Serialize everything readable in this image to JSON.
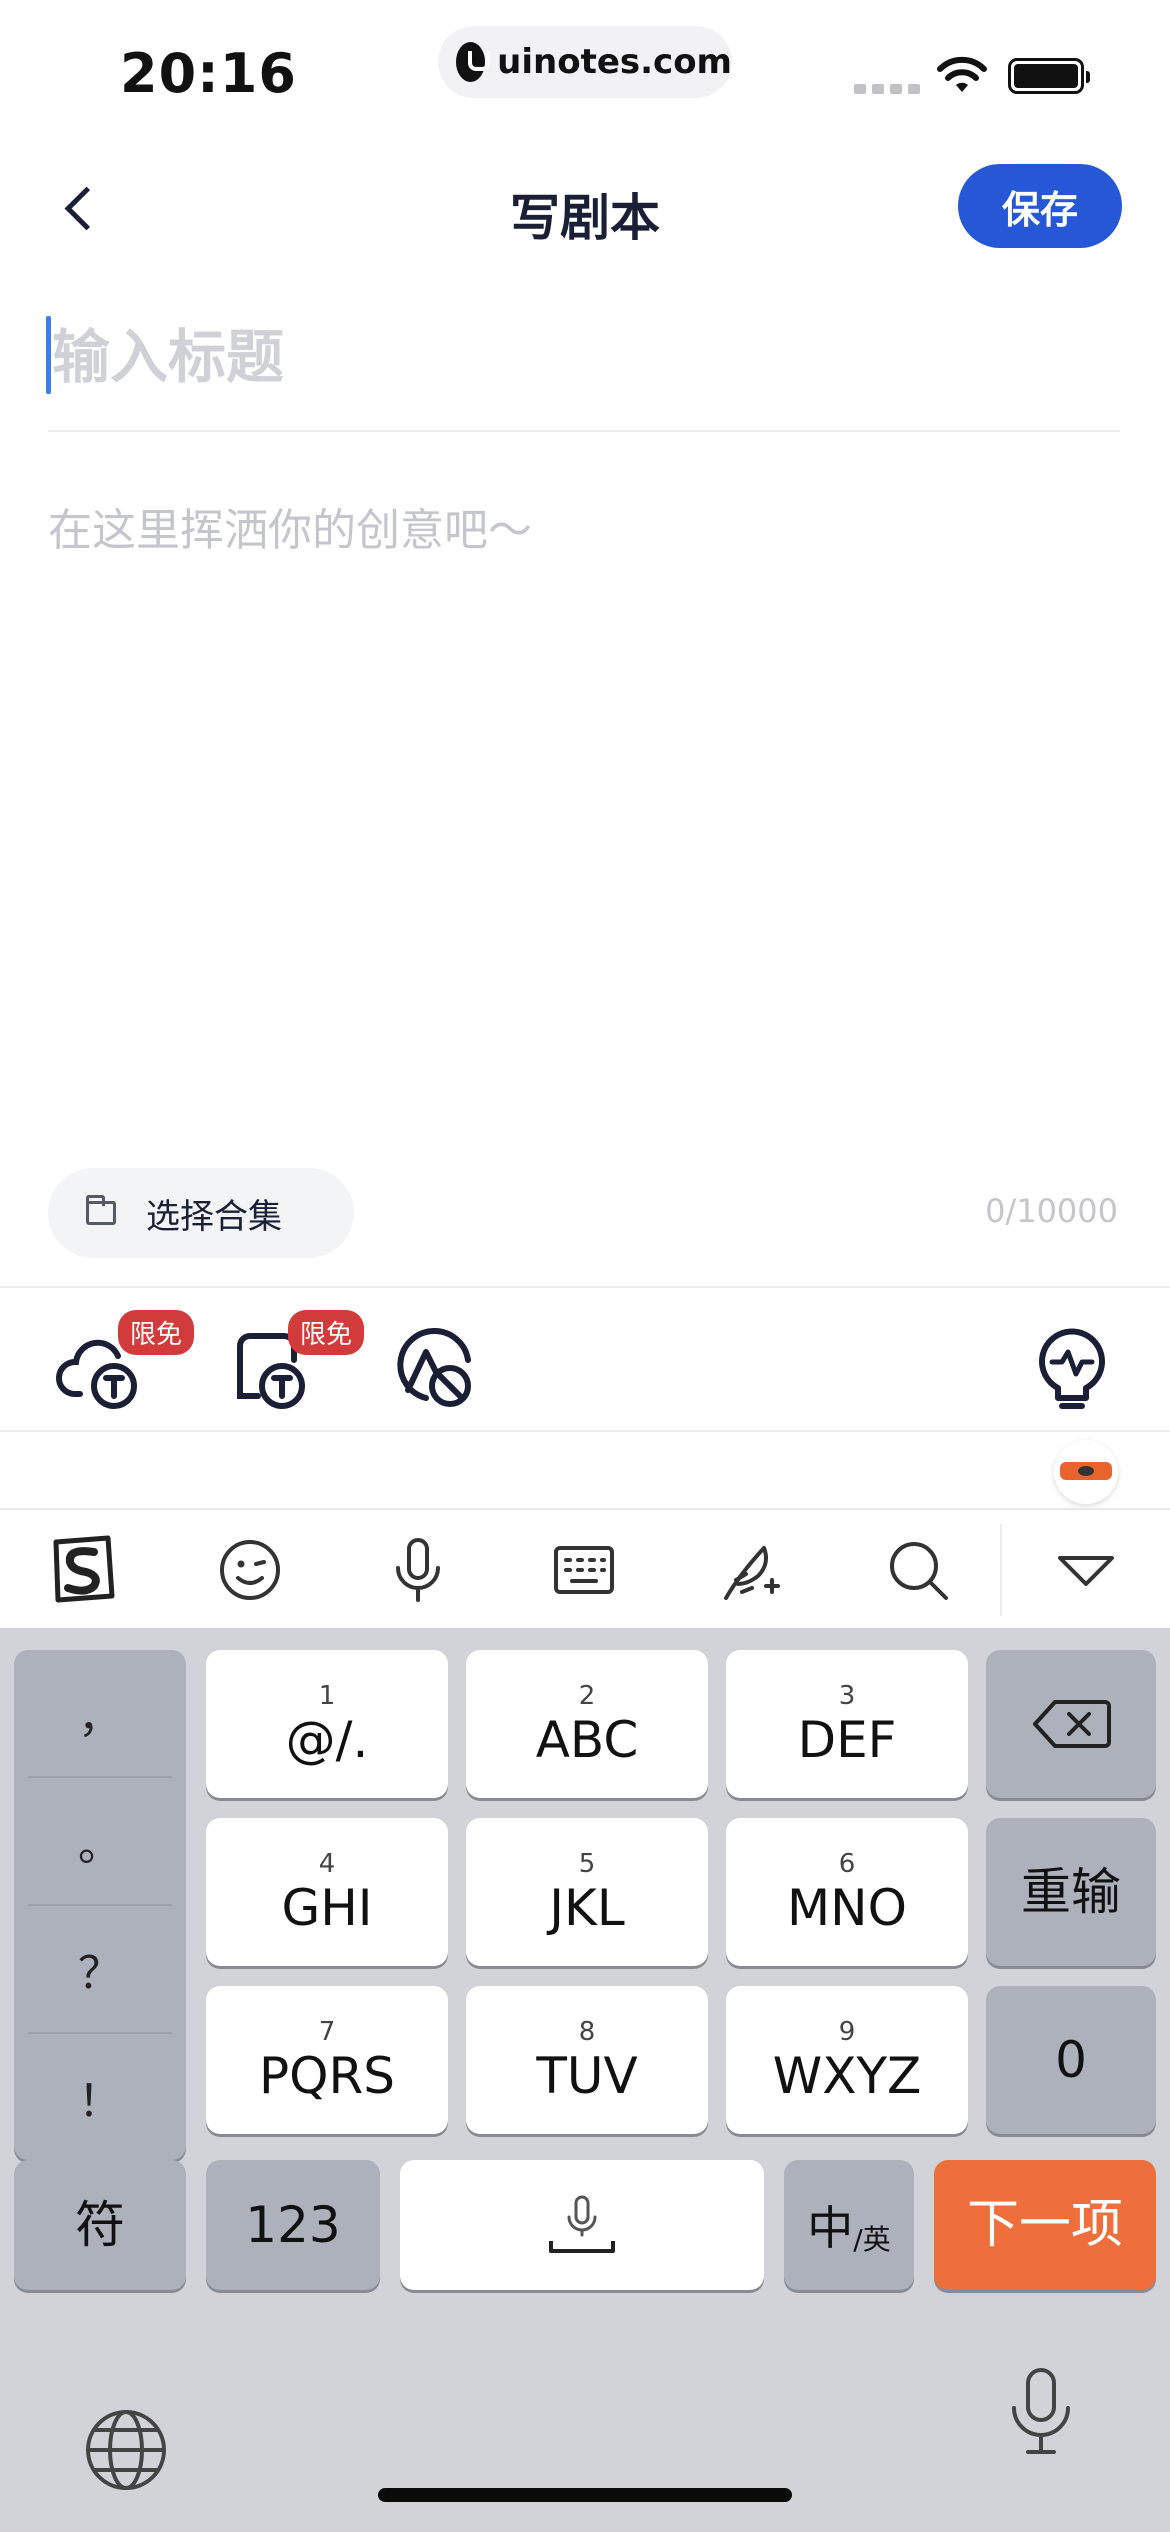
{
  "status_bar": {
    "time": "20:16",
    "url": "uinotes.com"
  },
  "nav": {
    "title": "写剧本",
    "save_label": "保存"
  },
  "editor": {
    "title_placeholder": "输入标题",
    "body_placeholder": "在这里挥洒你的创意吧～",
    "collection_label": "选择合集",
    "counter": "0/10000"
  },
  "tools": [
    {
      "icon": "cloud-text-tool-icon",
      "badge": "限免"
    },
    {
      "icon": "square-text-tool-icon",
      "badge": "限免"
    },
    {
      "icon": "triangle-circle-tool-icon",
      "badge": ""
    },
    {
      "icon": "lightbulb-icon",
      "badge": ""
    }
  ],
  "ime_toolbar": [
    "sogou-logo-icon",
    "emoji-icon",
    "microphone-icon",
    "keyboard-icon",
    "quill-icon",
    "search-icon",
    "collapse-icon"
  ],
  "keyboard": {
    "symbols": [
      "，",
      "。",
      "？",
      "！"
    ],
    "rows": [
      [
        {
          "num": "1",
          "main": "@/."
        },
        {
          "num": "2",
          "main": "ABC"
        },
        {
          "num": "3",
          "main": "DEF"
        }
      ],
      [
        {
          "num": "4",
          "main": "GHI"
        },
        {
          "num": "5",
          "main": "JKL"
        },
        {
          "num": "6",
          "main": "MNO"
        }
      ],
      [
        {
          "num": "7",
          "main": "PQRS"
        },
        {
          "num": "8",
          "main": "TUV"
        },
        {
          "num": "9",
          "main": "WXYZ"
        }
      ]
    ],
    "reinput_label": "重输",
    "zero_label": "0",
    "symbol_key": "符",
    "numbers_key": "123",
    "lang_main": "中",
    "lang_sub": "/英",
    "next_label": "下一项"
  },
  "colors": {
    "accent": "#2557d6",
    "badge": "#d23b3b",
    "next_key": "#ee6f3c"
  }
}
